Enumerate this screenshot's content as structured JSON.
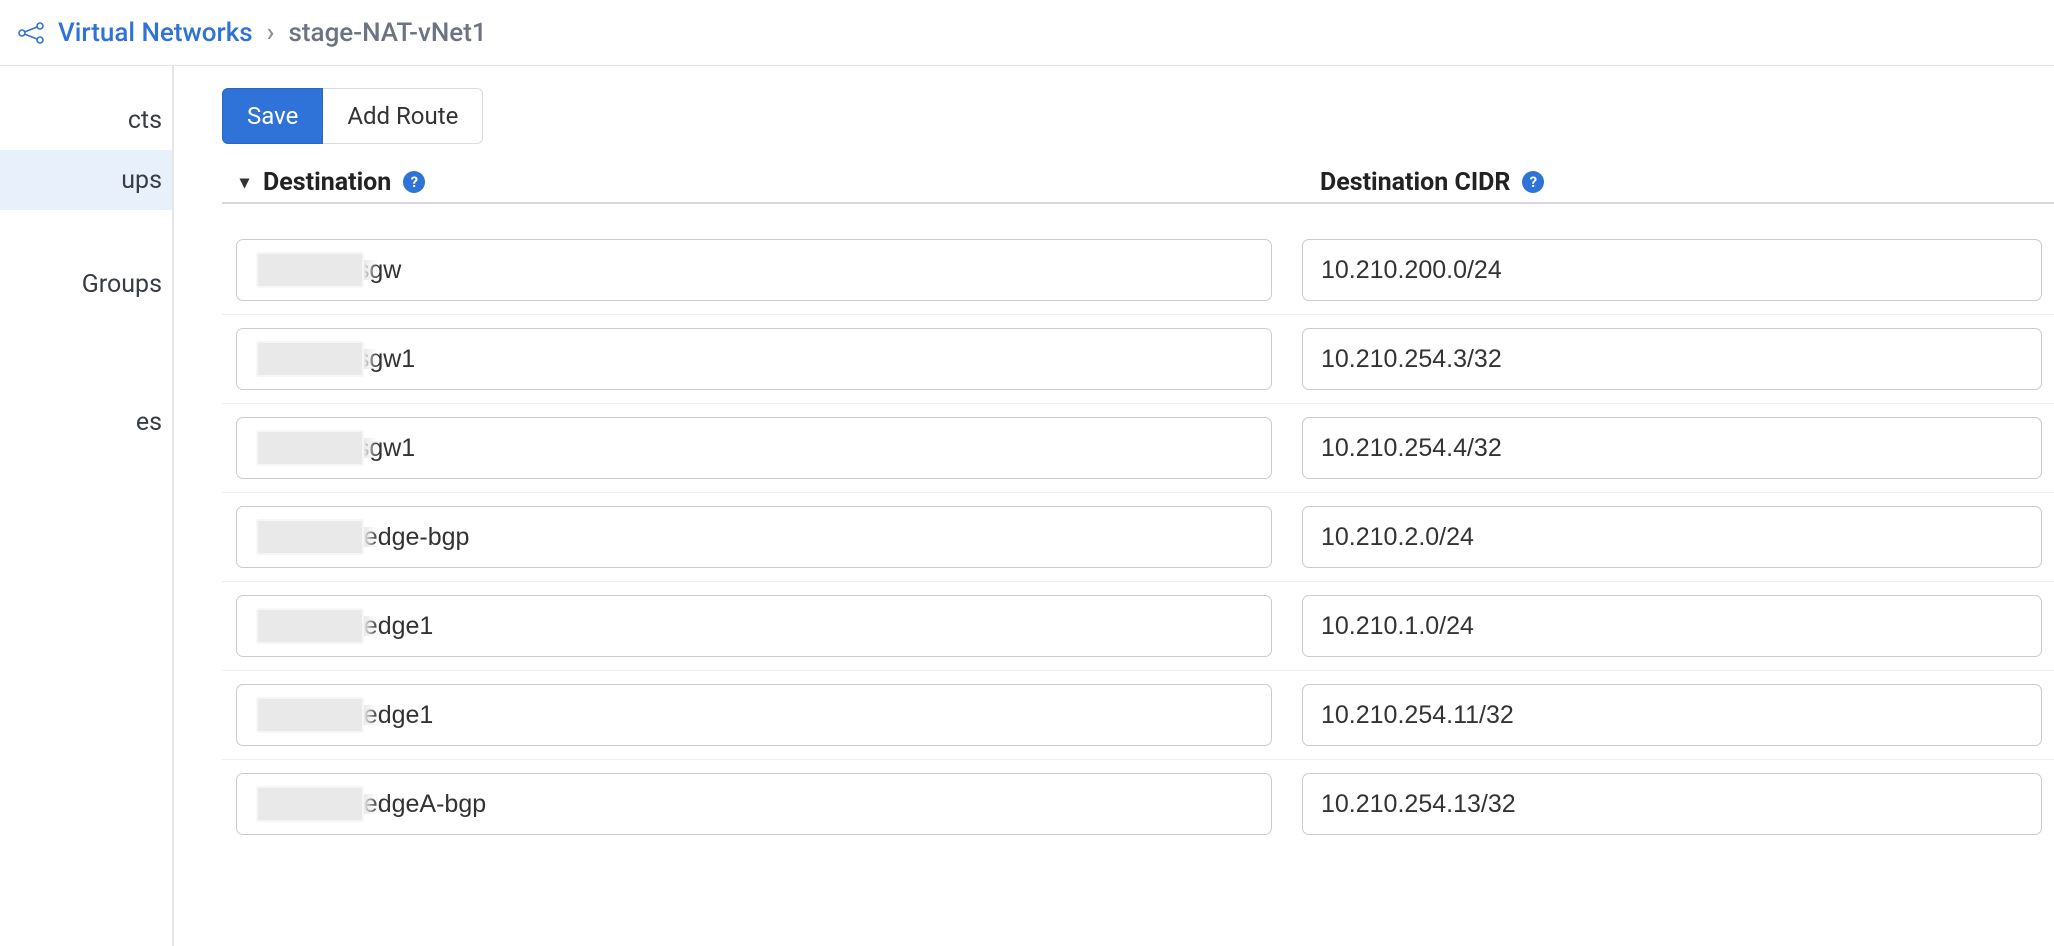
{
  "breadcrumb": {
    "parent_label": "Virtual Networks",
    "current_label": "stage-NAT-vNet1"
  },
  "sidebar": {
    "items": [
      {
        "label": "cts",
        "active": false
      },
      {
        "label": "ups",
        "active": true
      },
      {
        "label": "Groups",
        "active": false
      },
      {
        "label": "es",
        "active": false
      }
    ]
  },
  "toolbar": {
    "save_label": "Save",
    "add_route_label": "Add Route"
  },
  "table": {
    "columns": {
      "destination": "Destination",
      "cidr": "Destination CIDR"
    },
    "rows": [
      {
        "destination": "        -awsgw",
        "cidr": "10.210.200.0/24"
      },
      {
        "destination": "        -awsgw1",
        "cidr": "10.210.254.3/32"
      },
      {
        "destination": "        -awsgw1",
        "cidr": "10.210.254.4/32"
      },
      {
        "destination": "        -esxedge-bgp",
        "cidr": "10.210.2.0/24"
      },
      {
        "destination": "        -esxedge1",
        "cidr": "10.210.1.0/24"
      },
      {
        "destination": "        -esxedge1",
        "cidr": "10.210.254.11/32"
      },
      {
        "destination": "        -esxedgeA-bgp",
        "cidr": "10.210.254.13/32"
      }
    ]
  }
}
